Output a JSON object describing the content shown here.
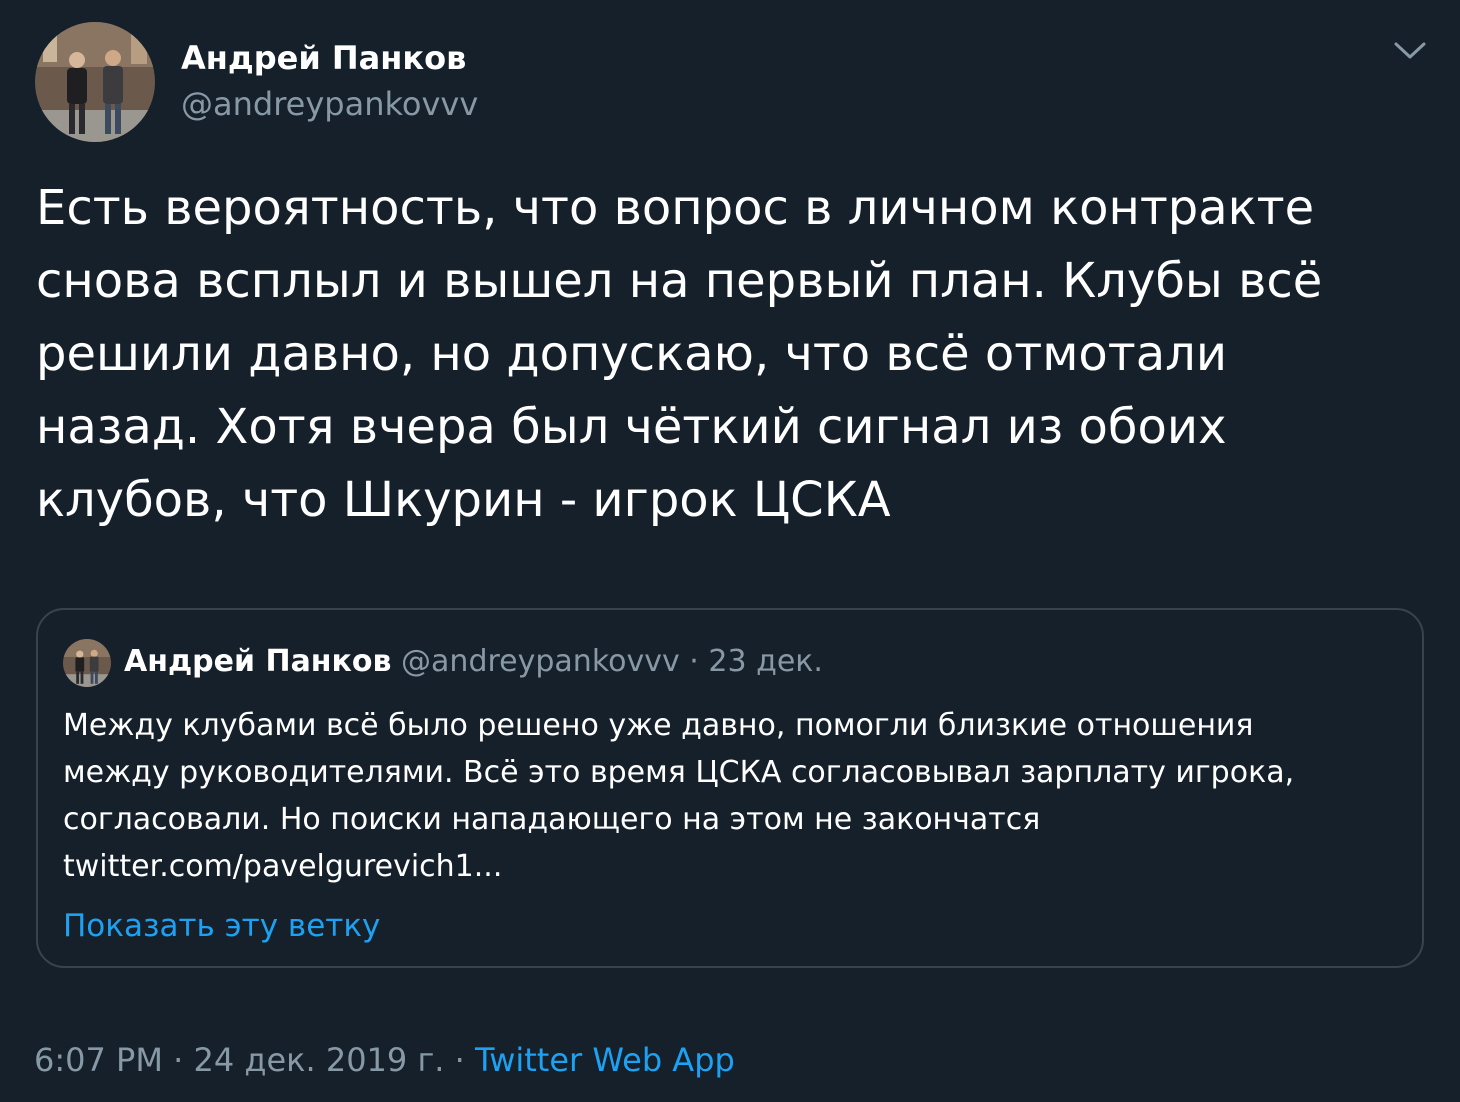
{
  "tweet": {
    "author_name": "Андрей Панков",
    "author_handle": "@andreypankovvv",
    "avatar_icon": "avatar-photo",
    "menu_icon": "chevron-down-icon",
    "text_lines": [
      "Есть вероятность, что вопрос в личном контракте",
      "снова всплыл и вышел на первый план. Клубы всё",
      "решили давно, но допускаю, что всё отмотали",
      "назад. Хотя вчера был чёткий сигнал из обоих",
      "клубов, что Шкурин - игрок ЦСКА"
    ],
    "time": "6:07 PM",
    "date": "24 дек. 2019 г.",
    "separator": "·",
    "source": "Twitter Web App"
  },
  "quoted": {
    "author_name": "Андрей Панков",
    "author_handle": "@andreypankovvv",
    "separator": "·",
    "date": "23 дек.",
    "text_lines": [
      "Между клубами всё было решено уже давно, помогли близкие отношения",
      "между руководителями. Всё это время ЦСКА согласовывал зарплату игрока,",
      "согласовали. Но поиски нападающего на этом не закончатся",
      "twitter.com/pavelgurevich1..."
    ],
    "show_thread": "Показать эту ветку"
  },
  "colors": {
    "background": "#15202b",
    "text": "#ffffff",
    "secondary_text": "#8899a6",
    "accent": "#1da1f2",
    "border": "#38444d"
  }
}
